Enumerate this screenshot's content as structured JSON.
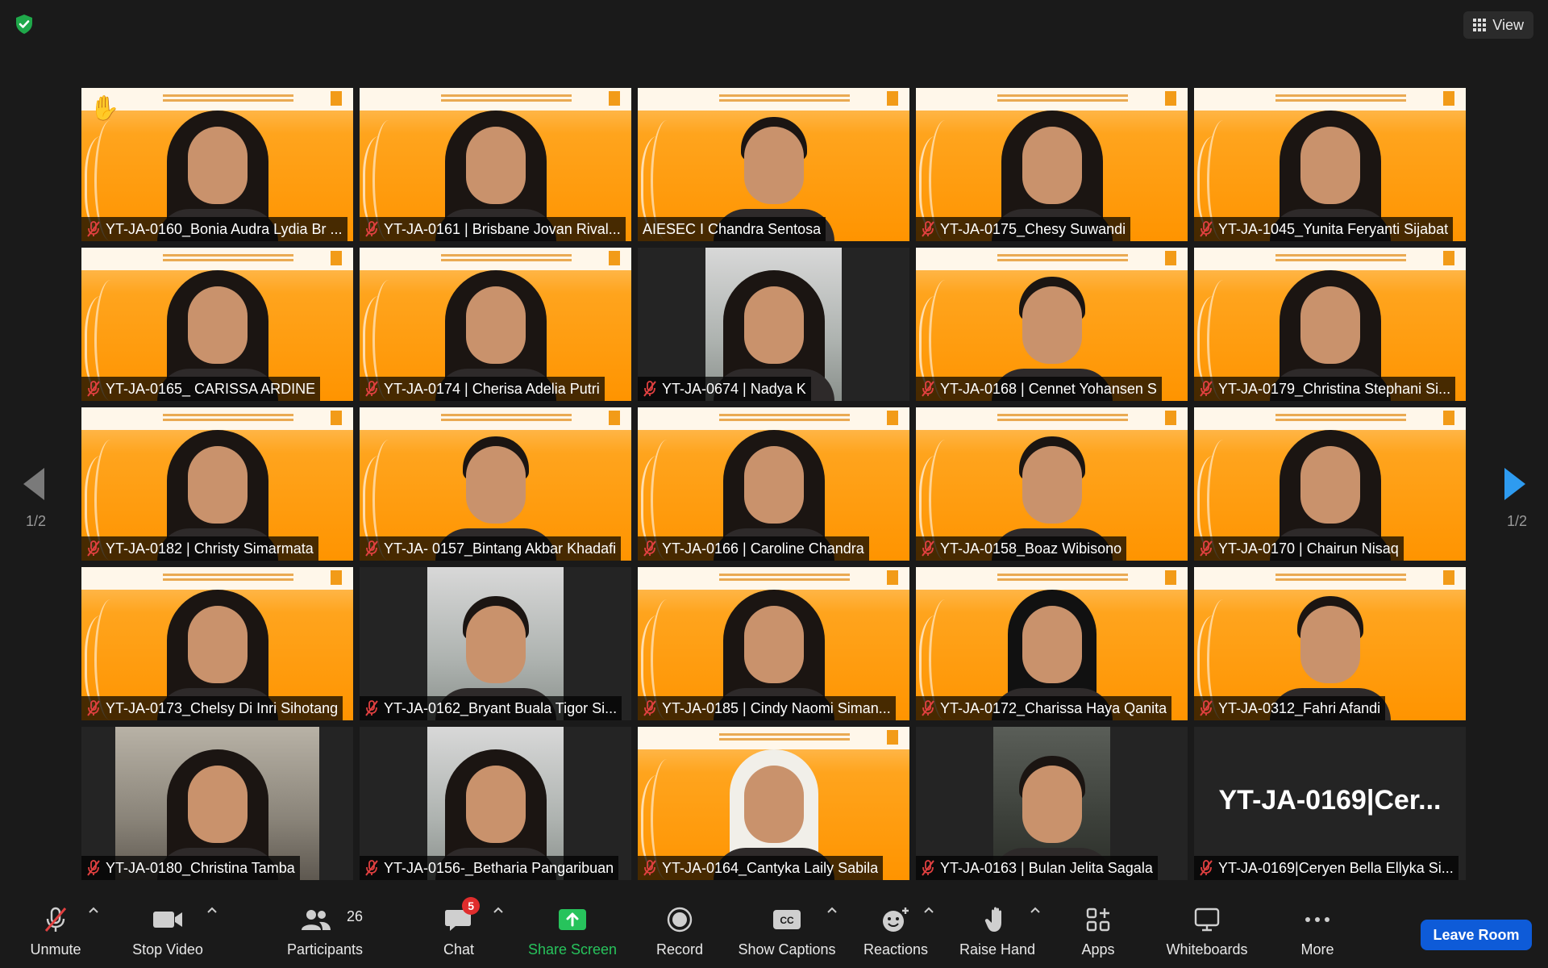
{
  "topbar": {
    "view_label": "View"
  },
  "pager": {
    "left": "1/2",
    "right": "1/2"
  },
  "tiles": [
    {
      "name": "YT-JA-0160_Bonia Audra Lydia Br ...",
      "bg": "orange",
      "hand_raised": true,
      "active": false
    },
    {
      "name": "YT-JA-0161 | Brisbane Jovan Rival...",
      "bg": "orange",
      "hand_raised": false,
      "active": false
    },
    {
      "name": "AIESEC I Chandra Sentosa",
      "bg": "orange",
      "hand_raised": false,
      "active": true,
      "muted": false
    },
    {
      "name": "YT-JA-0175_Chesy Suwandi",
      "bg": "orange",
      "hand_raised": false,
      "active": false
    },
    {
      "name": "YT-JA-1045_Yunita Feryanti Sijabat",
      "bg": "orange",
      "hand_raised": false,
      "active": false
    },
    {
      "name": "YT-JA-0165_ CARISSA ARDINE",
      "bg": "orange",
      "hand_raised": false,
      "active": false
    },
    {
      "name": "YT-JA-0174 | Cherisa Adelia Putri",
      "bg": "orange",
      "hand_raised": false,
      "active": false
    },
    {
      "name": "YT-JA-0674 | Nadya K",
      "bg": "dim",
      "hand_raised": false,
      "active": false
    },
    {
      "name": "YT-JA-0168 | Cennet Yohansen S",
      "bg": "orange",
      "hand_raised": false,
      "active": false
    },
    {
      "name": "YT-JA-0179_Christina Stephani Si...",
      "bg": "orange",
      "hand_raised": false,
      "active": false
    },
    {
      "name": "YT-JA-0182 | Christy Simarmata",
      "bg": "orange",
      "hand_raised": false,
      "active": false
    },
    {
      "name": "YT-JA- 0157_Bintang Akbar Khadafi",
      "bg": "orange",
      "hand_raised": false,
      "active": false
    },
    {
      "name": "YT-JA-0166 | Caroline Chandra",
      "bg": "orange",
      "hand_raised": false,
      "active": false
    },
    {
      "name": "YT-JA-0158_Boaz Wibisono",
      "bg": "orange",
      "hand_raised": false,
      "active": false
    },
    {
      "name": "YT-JA-0170 | Chairun Nisaq",
      "bg": "orange",
      "hand_raised": false,
      "active": false
    },
    {
      "name": "YT-JA-0173_Chelsy Di Inri Sihotang",
      "bg": "orange",
      "hand_raised": false,
      "active": false
    },
    {
      "name": "YT-JA-0162_Bryant Buala Tigor Si...",
      "bg": "dim",
      "hand_raised": false,
      "active": false
    },
    {
      "name": "YT-JA-0185 | Cindy Naomi Siman...",
      "bg": "orange",
      "hand_raised": false,
      "active": false
    },
    {
      "name": "YT-JA-0172_Charissa Haya Qanita",
      "bg": "orange",
      "hand_raised": false,
      "active": false
    },
    {
      "name": "YT-JA-0312_Fahri Afandi",
      "bg": "orange",
      "hand_raised": false,
      "active": false
    },
    {
      "name": "YT-JA-0180_Christina Tamba",
      "bg": "room",
      "hand_raised": false,
      "active": false
    },
    {
      "name": "YT-JA-0156-_Betharia Pangaribuan",
      "bg": "dim",
      "hand_raised": false,
      "active": false
    },
    {
      "name": "YT-JA-0164_Cantyka Laily Sabila",
      "bg": "orange",
      "hand_raised": false,
      "active": false
    },
    {
      "name": "YT-JA-0163 | Bulan Jelita Sagala",
      "bg": "dark",
      "hand_raised": false,
      "active": false
    },
    {
      "name": "YT-JA-0169|Ceryen Bella Ellyka Si...",
      "bg": "none",
      "hand_raised": false,
      "active": false,
      "big_name": "YT-JA-0169|Cer..."
    }
  ],
  "toolbar": {
    "unmute": "Unmute",
    "stop_video": "Stop Video",
    "participants": "Participants",
    "participants_count": "26",
    "chat": "Chat",
    "chat_badge": "5",
    "share_screen": "Share Screen",
    "record": "Record",
    "show_captions": "Show Captions",
    "reactions": "Reactions",
    "raise_hand": "Raise Hand",
    "apps": "Apps",
    "whiteboards": "Whiteboards",
    "more": "More",
    "leave": "Leave Room"
  },
  "colors": {
    "background": "#1a1a1a",
    "active_border": "#d7ea6e",
    "mic_muted": "#e04040",
    "share_green": "#27c35c",
    "leave_blue": "#0e5bd8",
    "badge_red": "#e02d2d"
  }
}
